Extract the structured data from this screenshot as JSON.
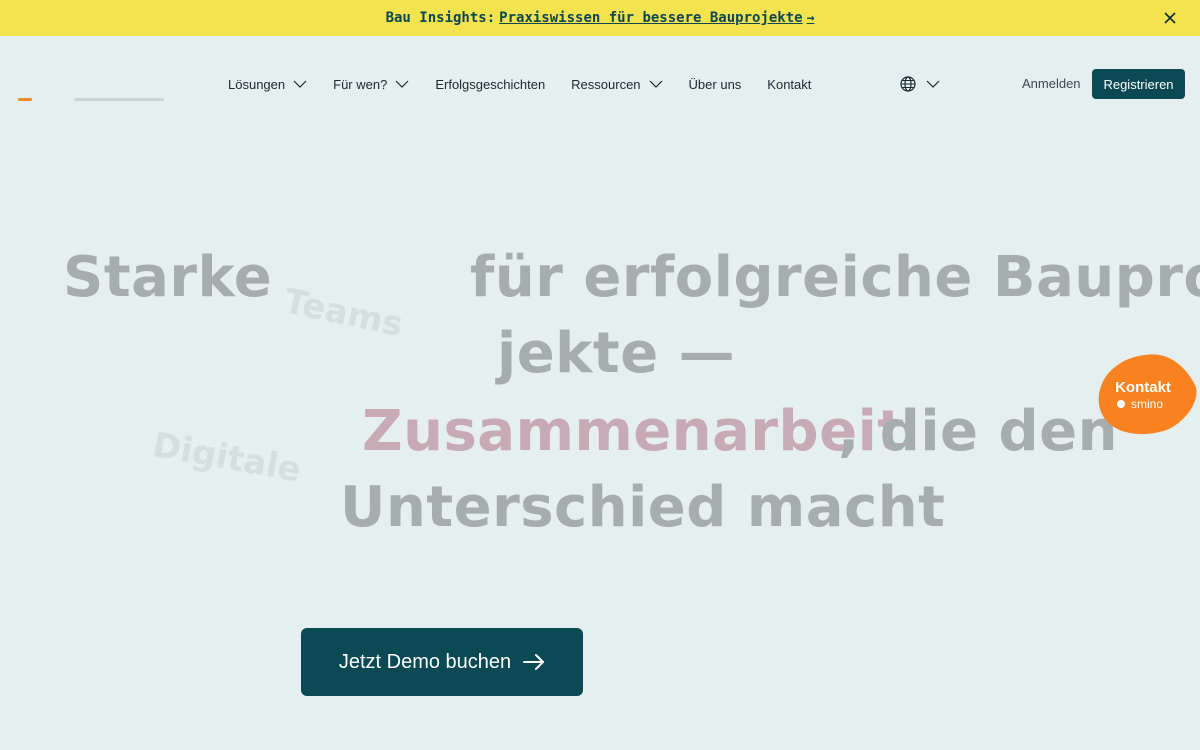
{
  "banner": {
    "prefix": "Bau Insights:",
    "link_text": "Praxiswissen für bessere Bauprojekte",
    "arrow": "→",
    "close_icon": "close-icon"
  },
  "nav": {
    "items": [
      {
        "label": "Lösungen",
        "has_dropdown": true
      },
      {
        "label": "Für wen?",
        "has_dropdown": true
      },
      {
        "label": "Erfolgsgeschichten",
        "has_dropdown": false
      },
      {
        "label": "Ressourcen",
        "has_dropdown": true
      },
      {
        "label": "Über uns",
        "has_dropdown": false
      },
      {
        "label": "Kontakt",
        "has_dropdown": false
      }
    ],
    "language_icon": "globe-icon",
    "login_label": "Anmelden",
    "register_label": "Registrieren"
  },
  "hero": {
    "word_starke": "Starke",
    "word_fuer": "für erfolgreiche Baupro-",
    "word_jekte": "jekte —",
    "word_zusammen": "Zusammenarbeit",
    "word_komma": ", die den",
    "word_unter": "Unterschied macht",
    "float_teams": "Teams",
    "float_digitale": "Digitale",
    "cta_label": "Jetzt Demo buchen"
  },
  "contact_widget": {
    "title": "Kontakt",
    "brand": "smino"
  },
  "colors": {
    "banner_bg": "#f2e34f",
    "primary": "#0b4955",
    "accent_orange": "#f7821f",
    "background": "#e5eff0",
    "highlight_word": "#c7aab3"
  }
}
